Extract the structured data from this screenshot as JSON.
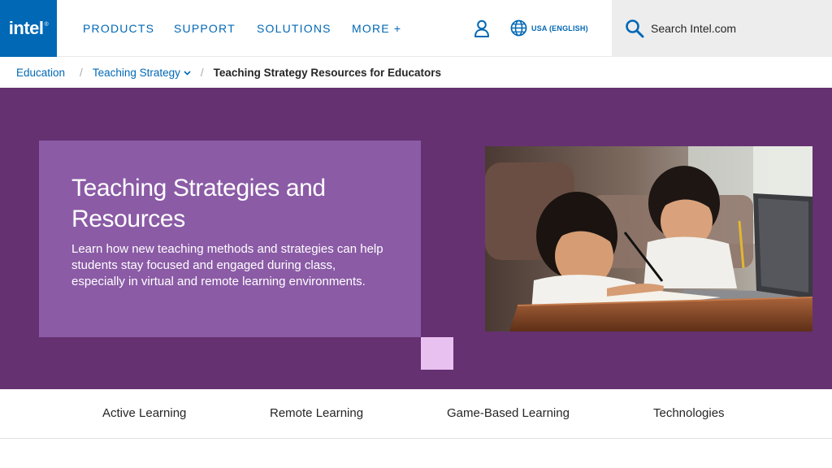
{
  "header": {
    "logo_text": "intel",
    "logo_mark": "®",
    "nav": [
      "PRODUCTS",
      "SUPPORT",
      "SOLUTIONS",
      "MORE +"
    ],
    "account_icon": "user-icon",
    "language_icon": "globe-icon",
    "language_label": "USA (ENGLISH)",
    "search_icon": "search-icon",
    "search_placeholder": "Search Intel.com"
  },
  "breadcrumb": {
    "items": [
      "Education",
      "Teaching Strategy",
      "Teaching Strategy Resources for Educators"
    ],
    "separator": "/"
  },
  "hero": {
    "title": "Teaching Strategies and Resources",
    "description": "Learn how new teaching methods and strategies can help students stay focused and engaged during class, especially in virtual and remote learning environments.",
    "image_alt": "Two young girls studying at a table with a laptop"
  },
  "tabs": [
    "Active Learning",
    "Remote Learning",
    "Game-Based Learning",
    "Technologies"
  ],
  "colors": {
    "brand_blue": "#0068b5",
    "hero_bg": "#653171",
    "hero_card": "#8b5ba6",
    "accent_square": "#e9c1f1"
  }
}
